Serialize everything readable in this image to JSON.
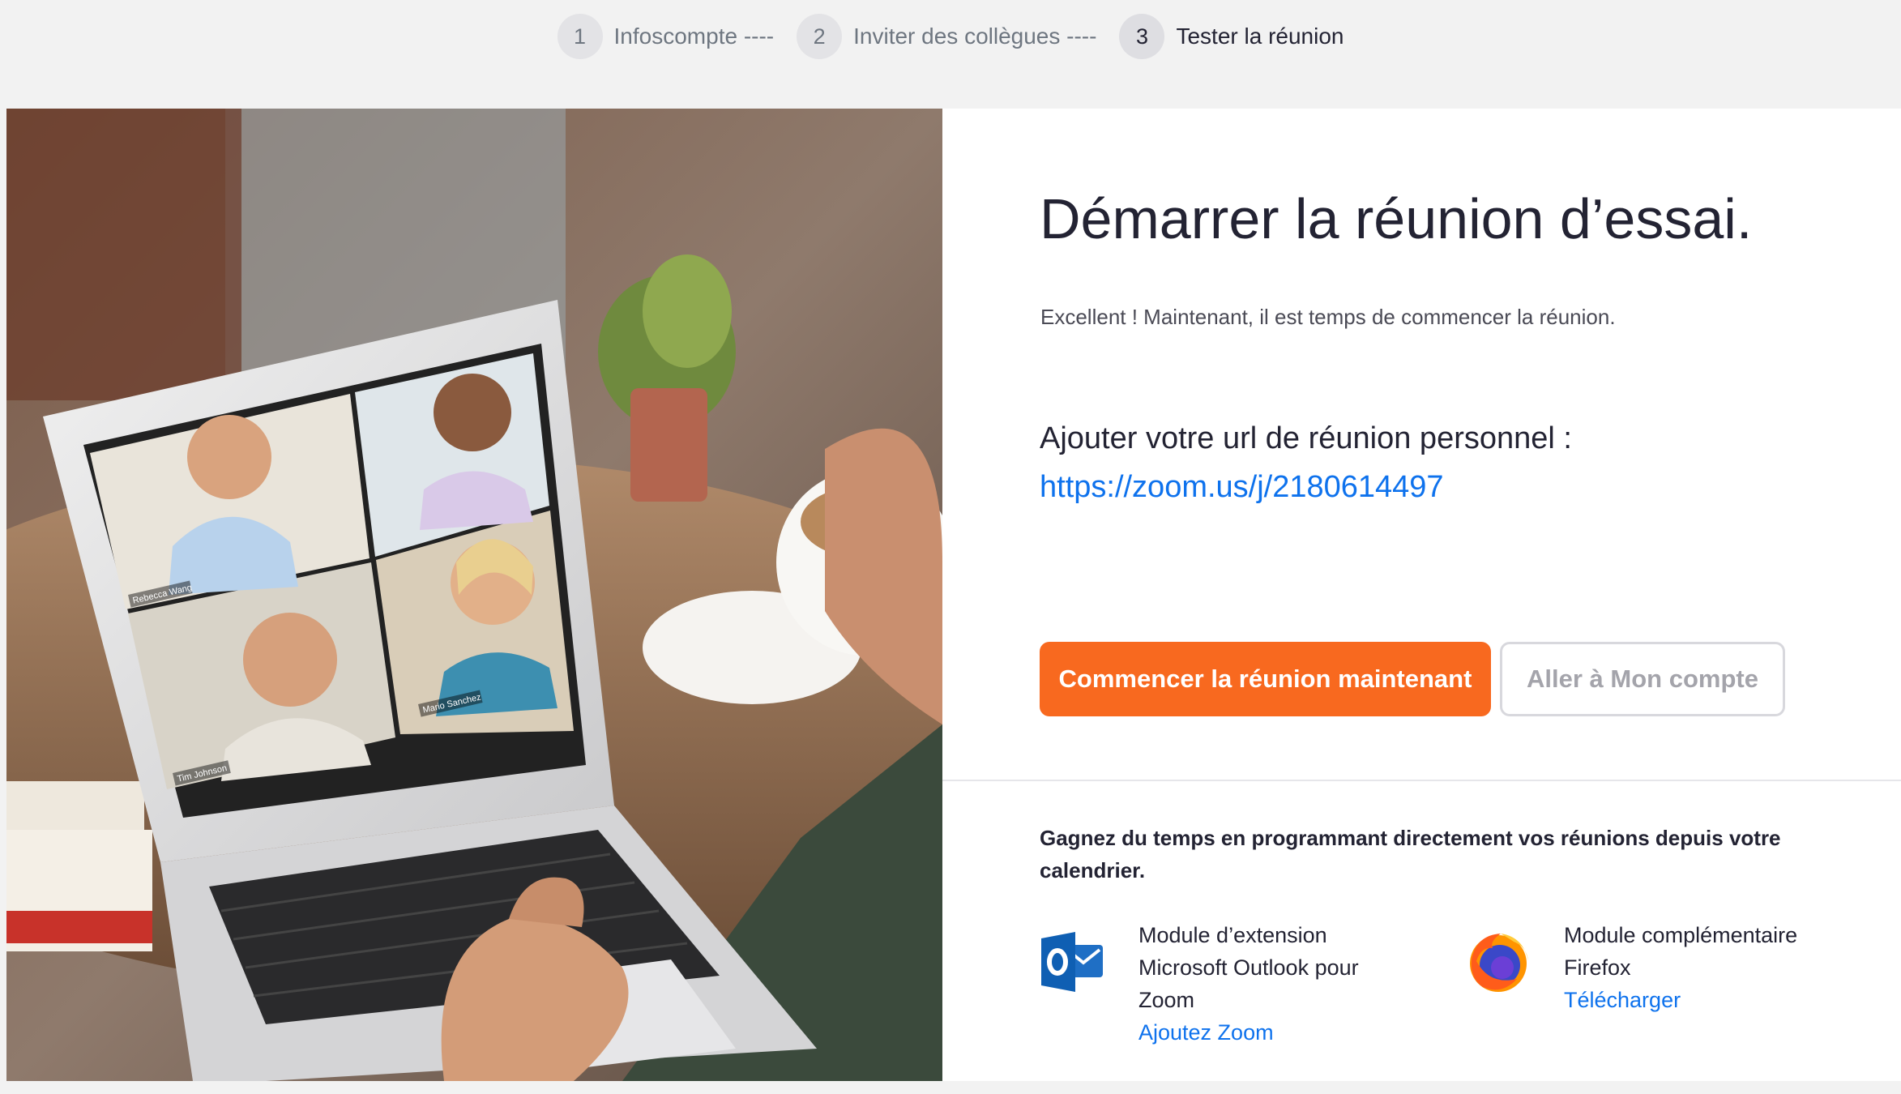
{
  "stepper": {
    "steps": [
      {
        "number": "1",
        "label": "Infoscompte ----"
      },
      {
        "number": "2",
        "label": "Inviter des collègues ----"
      },
      {
        "number": "3",
        "label": "Tester la réunion"
      }
    ],
    "active_step": 3
  },
  "main": {
    "title": "Démarrer la réunion d’essai.",
    "subtitle": "Excellent ! Maintenant, il est temps de commencer la réunion.",
    "url_label": "Ajouter votre url de réunion personnel :",
    "url": "https://zoom.us/j/2180614497",
    "primary_button": "Commencer la réunion maintenant",
    "secondary_button": "Aller à Mon compte"
  },
  "calendar": {
    "text": "Gagnez du temps en programmant directement vos réunions depuis votre calendrier.",
    "plugins": [
      {
        "icon": "outlook-icon",
        "lines": [
          "Module d’extension",
          "Microsoft Outlook pour",
          "Zoom"
        ],
        "link": "Ajoutez Zoom"
      },
      {
        "icon": "firefox-icon",
        "lines": [
          "Module complémentaire",
          "Firefox"
        ],
        "link": "Télécharger"
      }
    ]
  },
  "hero": {
    "name_tags": [
      "Rebecca Wang",
      "Tim Johnson",
      "Mario Sanchez"
    ]
  },
  "colors": {
    "accent_orange": "#f8691f",
    "link_blue": "#0e72ed",
    "text_dark": "#232333",
    "page_background": "#f2f2f2"
  }
}
